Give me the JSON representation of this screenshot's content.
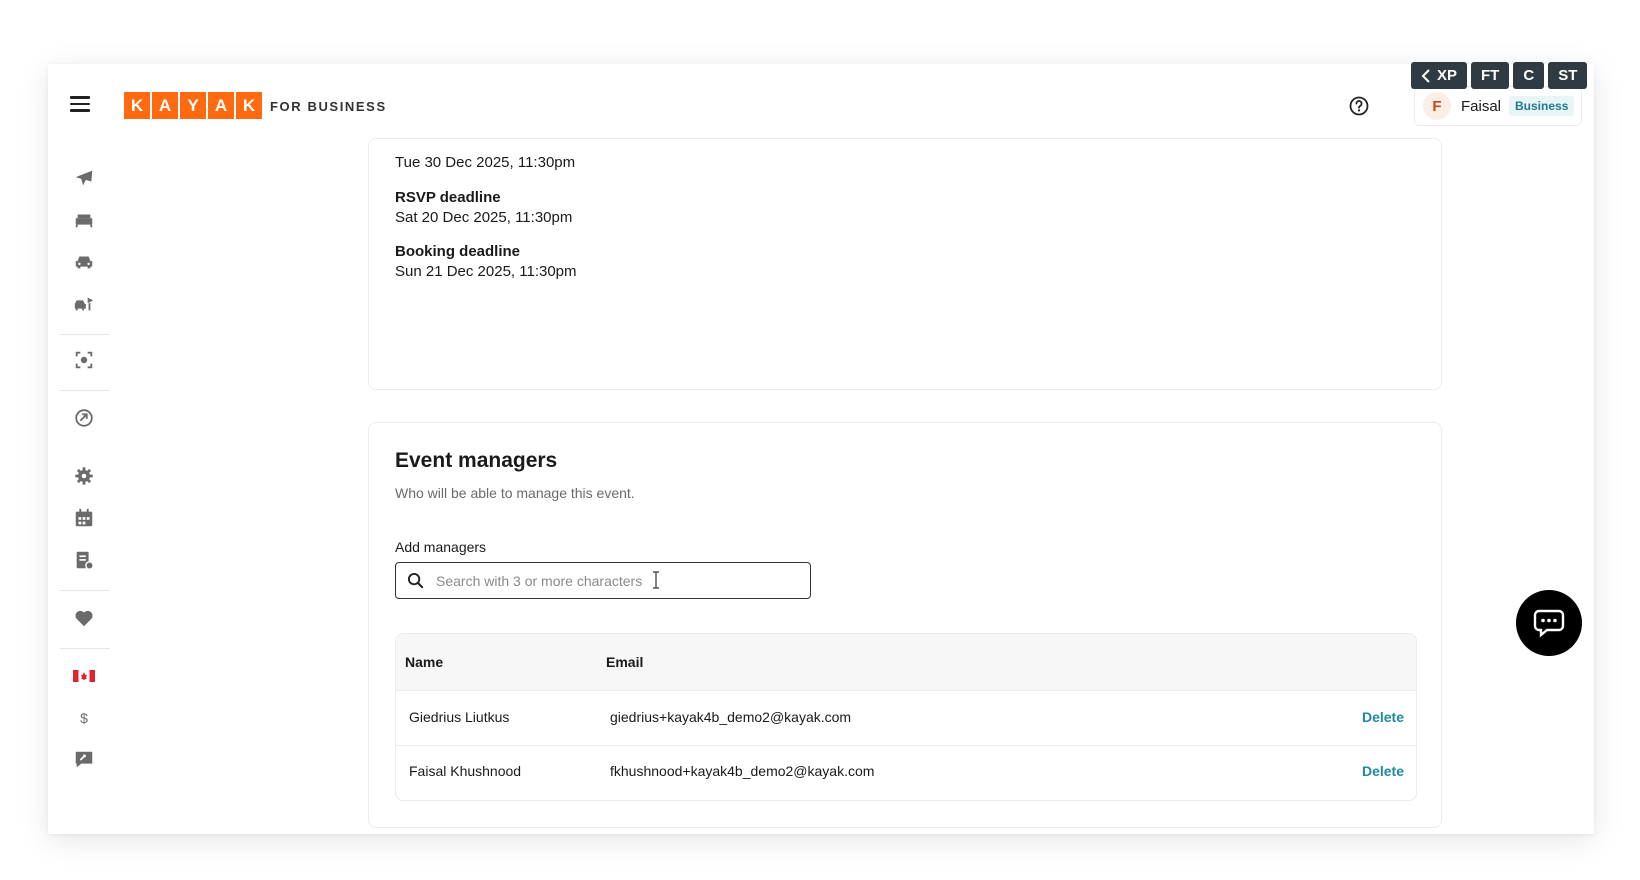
{
  "header": {
    "logo_letters": [
      "K",
      "A",
      "Y",
      "A",
      "K"
    ],
    "logo_subtitle": "FOR BUSINESS",
    "user": {
      "initial": "F",
      "name": "Faisal",
      "badge": "Business"
    }
  },
  "dev_buttons": {
    "xp": "XP",
    "ft": "FT",
    "c": "C",
    "st": "ST"
  },
  "sidebar": {
    "icons": [
      "flights-icon",
      "stays-icon",
      "cars-icon",
      "flight-hotel-icon",
      "explore-icon",
      "trips-icon",
      "settings-icon",
      "calendar-icon",
      "reports-icon",
      "favorites-icon",
      "canada-flag-icon",
      "currency-icon",
      "feedback-icon"
    ],
    "currency_symbol": "$"
  },
  "event_dates": {
    "end_value": "Tue 30 Dec 2025, 11:30pm",
    "rsvp_label": "RSVP deadline",
    "rsvp_value": "Sat 20 Dec 2025, 11:30pm",
    "booking_label": "Booking deadline",
    "booking_value": "Sun 21 Dec 2025, 11:30pm"
  },
  "managers": {
    "title": "Event managers",
    "subtitle": "Who will be able to manage this event.",
    "add_label": "Add managers",
    "search_placeholder": "Search with 3 or more characters",
    "search_value": "",
    "columns": {
      "name": "Name",
      "email": "Email"
    },
    "rows": [
      {
        "name": "Giedrius Liutkus",
        "email": "giedrius+kayak4b_demo2@kayak.com",
        "action": "Delete"
      },
      {
        "name": "Faisal Khushnood",
        "email": "fkhushnood+kayak4b_demo2@kayak.com",
        "action": "Delete"
      }
    ]
  },
  "colors": {
    "brand": "#ff690f",
    "link": "#1f8aa0",
    "badge": "#1f7a8c"
  }
}
